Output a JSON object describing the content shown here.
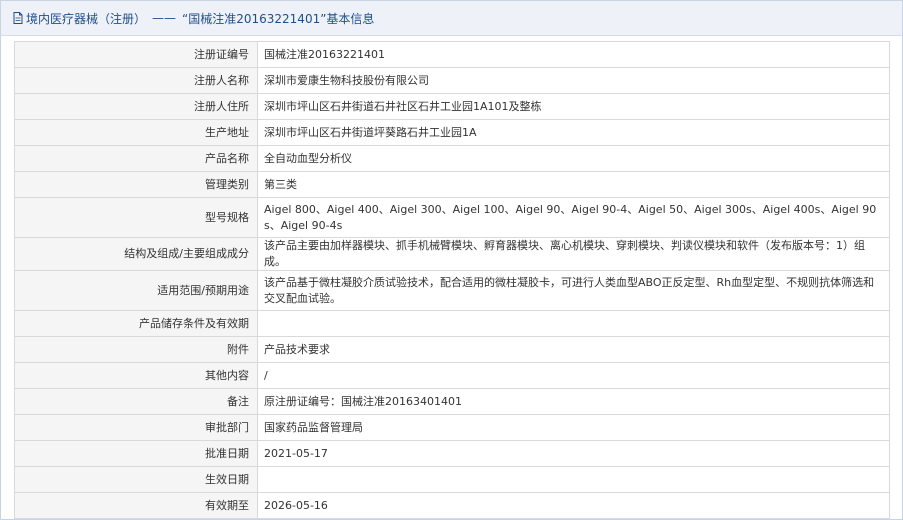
{
  "header": {
    "prefix": "境内医疗器械（注册）",
    "separator": "——",
    "title": "“国械注准20163221401”基本信息"
  },
  "rows": [
    {
      "label": "注册证编号",
      "value": "国械注准20163221401"
    },
    {
      "label": "注册人名称",
      "value": "深圳市爱康生物科技股份有限公司"
    },
    {
      "label": "注册人住所",
      "value": "深圳市坪山区石井街道石井社区石井工业园1A101及整栋"
    },
    {
      "label": "生产地址",
      "value": "深圳市坪山区石井街道坪葵路石井工业园1A"
    },
    {
      "label": "产品名称",
      "value": "全自动血型分析仪"
    },
    {
      "label": "管理类别",
      "value": "第三类"
    },
    {
      "label": "型号规格",
      "value": "Aigel 800、Aigel 400、Aigel 300、Aigel 100、Aigel 90、Aigel 90-4、Aigel 50、Aigel 300s、Aigel 400s、Aigel 90s、Aigel 90-4s"
    },
    {
      "label": "结构及组成/主要组成成分",
      "value": "该产品主要由加样器模块、抓手机械臂模块、孵育器模块、离心机模块、穿刺模块、判读仪模块和软件（发布版本号：1）组成。"
    },
    {
      "label": "适用范围/预期用途",
      "value": "该产品基于微柱凝胶介质试验技术，配合适用的微柱凝胶卡，可进行人类血型ABO正反定型、Rh血型定型、不规则抗体筛选和交叉配血试验。"
    },
    {
      "label": "产品储存条件及有效期",
      "value": ""
    },
    {
      "label": "附件",
      "value": "产品技术要求"
    },
    {
      "label": "其他内容",
      "value": "/"
    },
    {
      "label": "备注",
      "value": "原注册证编号：国械注准20163401401"
    },
    {
      "label": "审批部门",
      "value": "国家药品监督管理局"
    },
    {
      "label": "批准日期",
      "value": "2021-05-17"
    },
    {
      "label": "生效日期",
      "value": ""
    },
    {
      "label": "有效期至",
      "value": "2026-05-16"
    },
    {
      "label": "",
      "value": ""
    }
  ]
}
